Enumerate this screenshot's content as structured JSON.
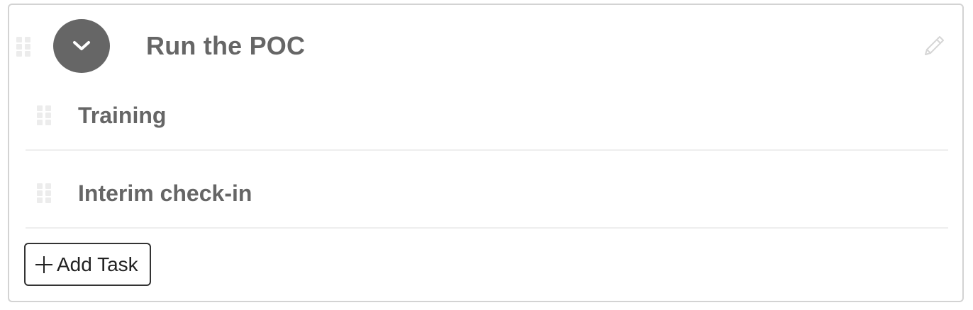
{
  "group": {
    "title": "Run the POC",
    "toggle_icon": "chevron-down-icon",
    "edit_icon": "pencil-icon",
    "drag_icon": "drag-handle-icon"
  },
  "tasks": [
    {
      "label": "Training"
    },
    {
      "label": "Interim check-in"
    }
  ],
  "add_task": {
    "icon": "plus-icon",
    "label": "Add Task"
  },
  "colors": {
    "title_text": "#666666",
    "toggle_bg": "#666666",
    "card_border": "#d3d3d3",
    "button_border": "#333333",
    "handle_dots": "#ececec"
  }
}
